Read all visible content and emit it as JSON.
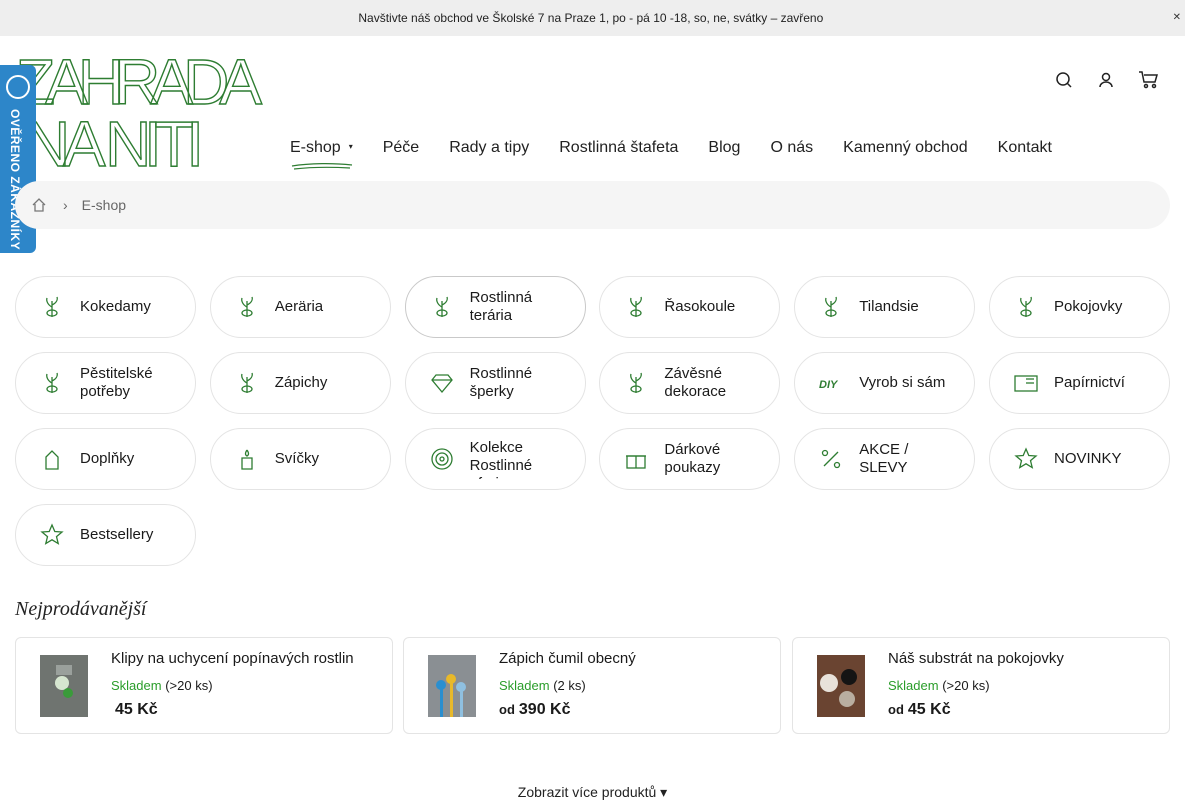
{
  "topbar": {
    "message": " Navštivte náš obchod ve Školské 7 na Praze 1, po - pá 10 -18, so, ne, svátky – zavřeno  ",
    "close": "✕"
  },
  "logo": {
    "text_line1": "ZAHRADA",
    "text_line2": "NA NITI"
  },
  "badge": {
    "text": "OVĚŘENO ZÁKAZNÍKY"
  },
  "nav": [
    {
      "label": "E-shop"
    },
    {
      "label": "Péče"
    },
    {
      "label": "Rady a tipy"
    },
    {
      "label": "Rostlinná štafeta"
    },
    {
      "label": "Blog"
    },
    {
      "label": "O nás"
    },
    {
      "label": "Kamenný obchod"
    },
    {
      "label": "Kontakt"
    }
  ],
  "nav_caret": "▾",
  "breadcrumb": {
    "separator": "›",
    "current": "E-shop"
  },
  "categories": [
    {
      "label": "Kokedamy"
    },
    {
      "label": "Aeräria"
    },
    {
      "label": "Rostlinná terária"
    },
    {
      "label": "Řasokoule"
    },
    {
      "label": "Tilandsie"
    },
    {
      "label": "Pokojovky"
    },
    {
      "label": "Pěstitelské potřeby"
    },
    {
      "label": "Zápichy"
    },
    {
      "label": "Rostlinné šperky"
    },
    {
      "label": "Závěsné dekorace"
    },
    {
      "label": "Vyrob si sám"
    },
    {
      "label": "Papírnictví"
    },
    {
      "label": "Doplňky"
    },
    {
      "label": "Svíčky"
    },
    {
      "label": "Kolekce Rostlinné aforimy"
    },
    {
      "label": "Dárkové poukazy"
    },
    {
      "label": "AKCE / SLEVY"
    },
    {
      "label": "NOVINKY"
    },
    {
      "label": "Bestsellery"
    }
  ],
  "bestsellers": {
    "title": "Nejprodávanější",
    "products": [
      {
        "name": "Klipy na uchycení popínavých rostlin",
        "stock": "Skladem",
        "qty": "(>20 ks)",
        "prefix": "",
        "price": "45 Kč"
      },
      {
        "name": "Zápich čumil obecný",
        "stock": "Skladem",
        "qty": "(2 ks)",
        "prefix": "od",
        "price": "390 Kč"
      },
      {
        "name": "Náš substrát na pokojovky",
        "stock": "Skladem",
        "qty": "(>20 ks)",
        "prefix": "od",
        "price": "45 Kč"
      }
    ]
  },
  "more_label": "Zobrazit více produktů ▾",
  "colors": {
    "accent_green": "#2e7d32",
    "stock_green": "#2a9d2a",
    "badge_blue": "#2d86c9"
  }
}
